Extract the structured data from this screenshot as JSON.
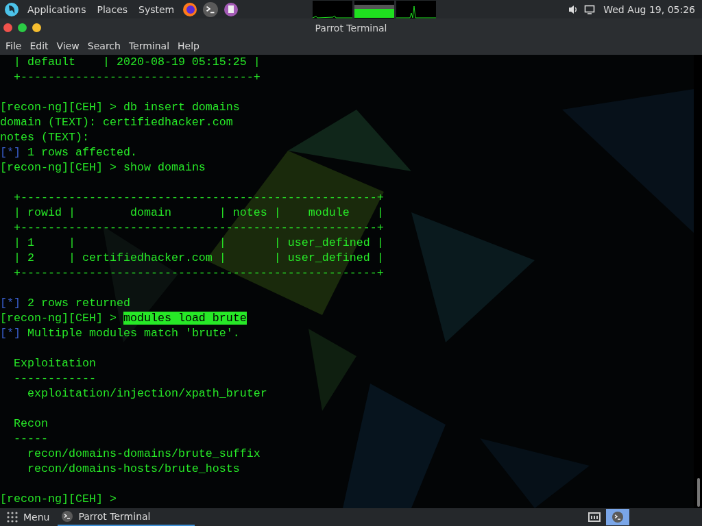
{
  "top_panel": {
    "menus": [
      "Applications",
      "Places",
      "System"
    ],
    "clock": "Wed Aug 19, 05:26"
  },
  "window": {
    "title": "Parrot Terminal",
    "menu": [
      "File",
      "Edit",
      "View",
      "Search",
      "Terminal",
      "Help"
    ]
  },
  "terminal": {
    "lines": [
      {
        "kind": "plain",
        "text": "  | default    | 2020-08-19 05:15:25 |"
      },
      {
        "kind": "plain",
        "text": "  +----------------------------------+"
      },
      {
        "kind": "blank"
      },
      {
        "kind": "prompt",
        "prompt": "[recon-ng][CEH] >",
        "command": "db insert domains"
      },
      {
        "kind": "plain",
        "text": "domain (TEXT): certifiedhacker.com"
      },
      {
        "kind": "plain",
        "text": "notes (TEXT):"
      },
      {
        "kind": "status",
        "marker": "[*]",
        "text": "1 rows affected."
      },
      {
        "kind": "prompt",
        "prompt": "[recon-ng][CEH] >",
        "command": "show domains"
      },
      {
        "kind": "blank"
      },
      {
        "kind": "plain",
        "text": "  +----------------------------------------------------+"
      },
      {
        "kind": "plain",
        "text": "  | rowid |        domain       | notes |    module    |"
      },
      {
        "kind": "plain",
        "text": "  +----------------------------------------------------+"
      },
      {
        "kind": "plain",
        "text": "  | 1     |                     |       | user_defined |"
      },
      {
        "kind": "plain",
        "text": "  | 2     | certifiedhacker.com |       | user_defined |"
      },
      {
        "kind": "plain",
        "text": "  +----------------------------------------------------+"
      },
      {
        "kind": "blank"
      },
      {
        "kind": "status",
        "marker": "[*]",
        "text": "2 rows returned"
      },
      {
        "kind": "prompt",
        "prompt": "[recon-ng][CEH] >",
        "command": "modules load brute",
        "highlighted": true
      },
      {
        "kind": "status",
        "marker": "[*]",
        "text": "Multiple modules match 'brute'."
      },
      {
        "kind": "blank"
      },
      {
        "kind": "plain",
        "text": "  Exploitation"
      },
      {
        "kind": "plain",
        "text": "  ------------"
      },
      {
        "kind": "plain",
        "text": "    exploitation/injection/xpath_bruter"
      },
      {
        "kind": "blank"
      },
      {
        "kind": "plain",
        "text": "  Recon"
      },
      {
        "kind": "plain",
        "text": "  -----"
      },
      {
        "kind": "plain",
        "text": "    recon/domains-domains/brute_suffix"
      },
      {
        "kind": "plain",
        "text": "    recon/domains-hosts/brute_hosts"
      },
      {
        "kind": "blank"
      },
      {
        "kind": "prompt",
        "prompt": "[recon-ng][CEH] >"
      }
    ]
  },
  "taskbar": {
    "menu_label": "Menu",
    "tasks": [
      {
        "label": "Parrot Terminal",
        "selected": true
      }
    ]
  }
}
